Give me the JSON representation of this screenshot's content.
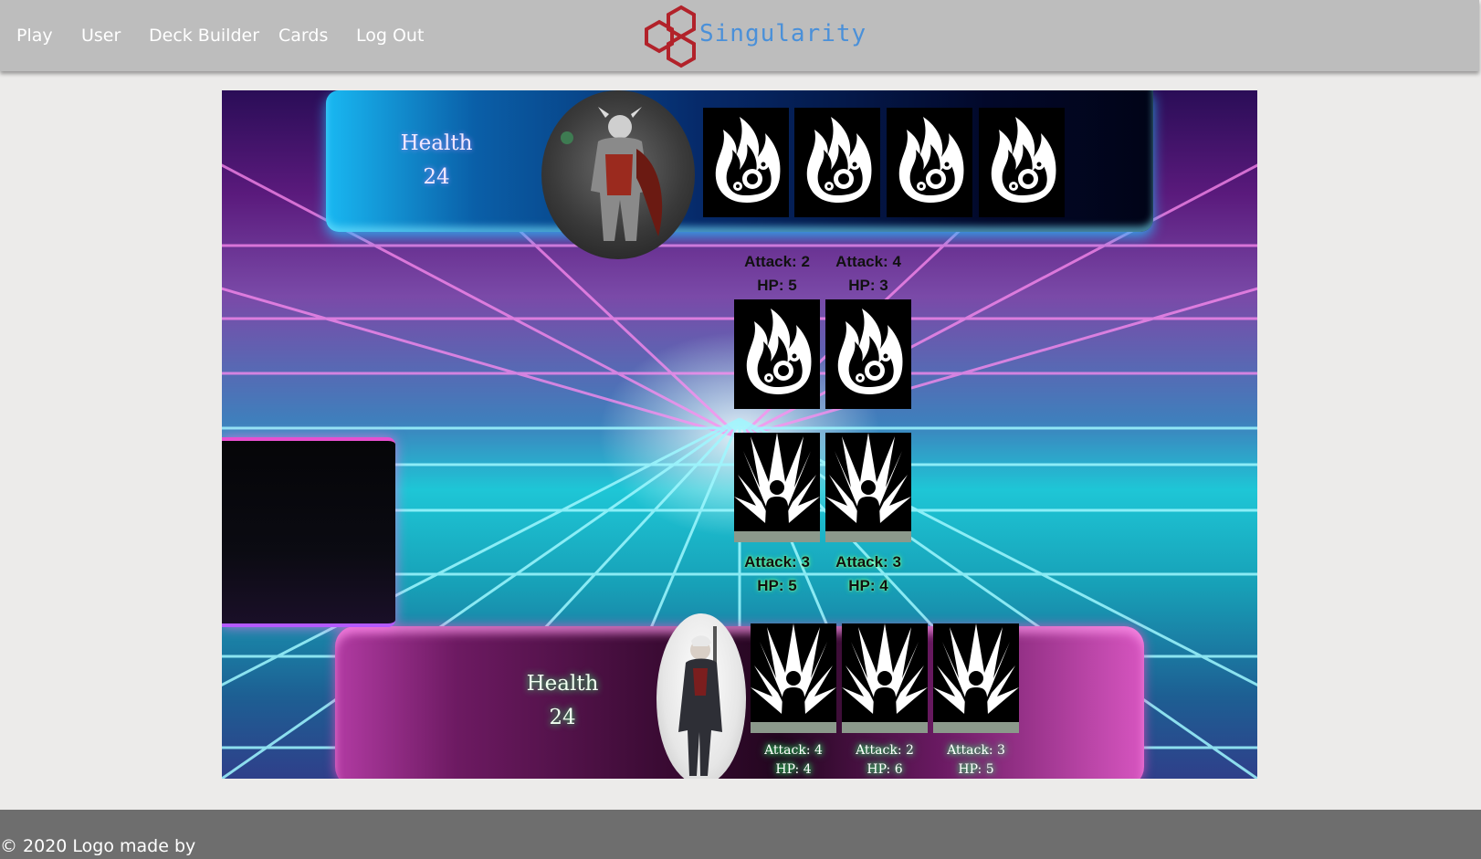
{
  "nav": {
    "links": [
      "Play",
      "User",
      "Deck Builder",
      "Cards",
      "Log Out"
    ],
    "logo_text": "Singularity"
  },
  "opponent": {
    "health_label": "Health",
    "health_value": "24",
    "hand": [
      {
        "icon": "fireball-card-icon"
      },
      {
        "icon": "fireball-card-icon"
      },
      {
        "icon": "fireball-card-icon"
      },
      {
        "icon": "fireball-card-icon"
      }
    ],
    "field": [
      {
        "icon": "fireball-card-icon",
        "attack": "Attack: 2",
        "hp": "HP: 5"
      },
      {
        "icon": "fireball-card-icon",
        "attack": "Attack: 4",
        "hp": "HP: 3"
      }
    ]
  },
  "player": {
    "health_label": "Health",
    "health_value": "24",
    "field": [
      {
        "icon": "summon-card-icon",
        "attack": "Attack: 3",
        "hp": "HP: 5"
      },
      {
        "icon": "summon-card-icon",
        "attack": "Attack: 3",
        "hp": "HP: 4"
      }
    ],
    "hand": [
      {
        "icon": "summon-card-icon",
        "attack": "Attack: 4",
        "hp": "HP: 4"
      },
      {
        "icon": "summon-card-icon",
        "attack": "Attack: 2",
        "hp": "HP: 6"
      },
      {
        "icon": "summon-card-icon",
        "attack": "Attack: 3",
        "hp": "HP: 5"
      }
    ]
  },
  "colors": {
    "nav_bg": "#bdbdbd",
    "logo_red": "#b2222a",
    "logo_blue": "#4a90d9",
    "opponent_panel": "#062a6a",
    "player_panel": "#6d1a62",
    "footer_bg": "#6e6e6e"
  },
  "footer": {
    "text": "© 2020 Logo made by"
  }
}
